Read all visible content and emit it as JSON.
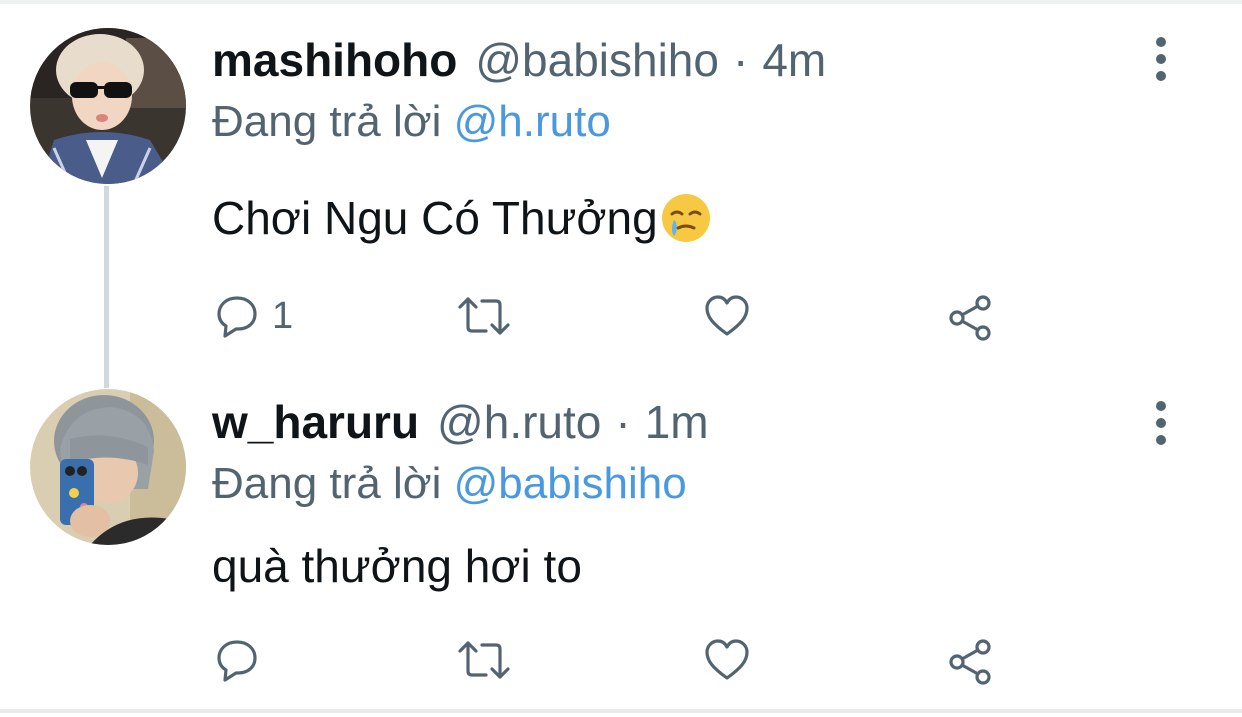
{
  "tweets": [
    {
      "display_name": "mashihoho",
      "handle": "@babishiho",
      "separator": "·",
      "time": "4m",
      "reply_prefix": "Đang trả lời",
      "reply_to": "@h.ruto",
      "text": "Chơi Ngu Có Thưởng",
      "emoji": "face-holding-back-tears",
      "reply_count": "1",
      "retweet_count": "",
      "like_count": ""
    },
    {
      "display_name": "w_haruru",
      "handle": "@h.ruto",
      "separator": "·",
      "time": "1m",
      "reply_prefix": "Đang trả lời",
      "reply_to": "@babishiho",
      "text": "quà thưởng hơi to",
      "reply_count": "",
      "retweet_count": "",
      "like_count": ""
    }
  ],
  "colors": {
    "primary_text": "#0f1419",
    "secondary_text": "#536471",
    "mention": "#4a99e0",
    "thread_line": "#cfd9de"
  },
  "icons": [
    "reply-icon",
    "retweet-icon",
    "like-icon",
    "share-icon",
    "more-options-icon"
  ]
}
